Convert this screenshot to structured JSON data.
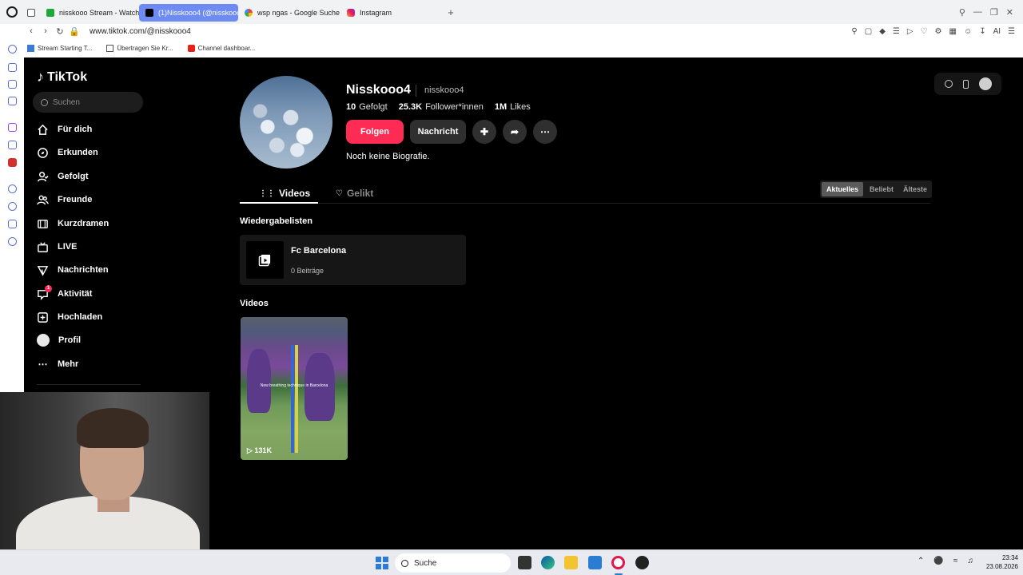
{
  "browser": {
    "tabs": [
      {
        "label": "nisskooo Stream - Watch L",
        "icon": "kick-icon"
      },
      {
        "label": "(1)Nisskooo4 (@nisskooo4",
        "icon": "tiktok-icon",
        "active": true
      },
      {
        "label": "wsp ngas - Google Suche",
        "icon": "google-icon"
      },
      {
        "label": "Instagram",
        "icon": "instagram-icon"
      }
    ],
    "url": "www.tiktok.com/@nisskooo4",
    "bookmarks": [
      "Stream Starting T...",
      "Übertragen Sie Kr...",
      "Channel dashboar..."
    ]
  },
  "tiktok": {
    "logo": "TikTok",
    "search_placeholder": "Suchen",
    "menu": [
      {
        "label": "Für dich",
        "icon": "home-icon"
      },
      {
        "label": "Erkunden",
        "icon": "compass-icon"
      },
      {
        "label": "Gefolgt",
        "icon": "following-icon"
      },
      {
        "label": "Freunde",
        "icon": "friends-icon"
      },
      {
        "label": "Kurzdramen",
        "icon": "drama-icon"
      },
      {
        "label": "LIVE",
        "icon": "live-icon"
      },
      {
        "label": "Nachrichten",
        "icon": "messages-icon"
      },
      {
        "label": "Aktivität",
        "icon": "activity-icon",
        "badge": "1"
      },
      {
        "label": "Hochladen",
        "icon": "upload-icon"
      },
      {
        "label": "Profil",
        "icon": "avatar"
      },
      {
        "label": "Mehr",
        "icon": "more-icon"
      }
    ],
    "profile": {
      "name": "Nisskooo4",
      "handle": "nisskooo4",
      "following_count": "10",
      "following_label": "Gefolgt",
      "followers_count": "25.3K",
      "followers_label": "Follower*innen",
      "likes_count": "1M",
      "likes_label": "Likes",
      "follow_button": "Folgen",
      "message_button": "Nachricht",
      "bio": "Noch keine Biografie."
    },
    "tabs": {
      "videos": "Videos",
      "liked": "Gelikt"
    },
    "sort": {
      "latest": "Aktuelles",
      "popular": "Beliebt",
      "oldest": "Älteste"
    },
    "playlists_heading": "Wiedergabelisten",
    "playlist": {
      "title": "Fc Barcelona",
      "count": "0 Beiträge"
    },
    "videos_heading": "Videos",
    "video": {
      "caption": "New breathing technique in Barcelona",
      "views": "131K"
    }
  },
  "taskbar": {
    "search": "Suche",
    "time": "23:34",
    "date": "23.08.2026"
  },
  "colors": {
    "accent": "#fe2c55",
    "active_tab": "#6d8bf2",
    "background": "#000000"
  }
}
